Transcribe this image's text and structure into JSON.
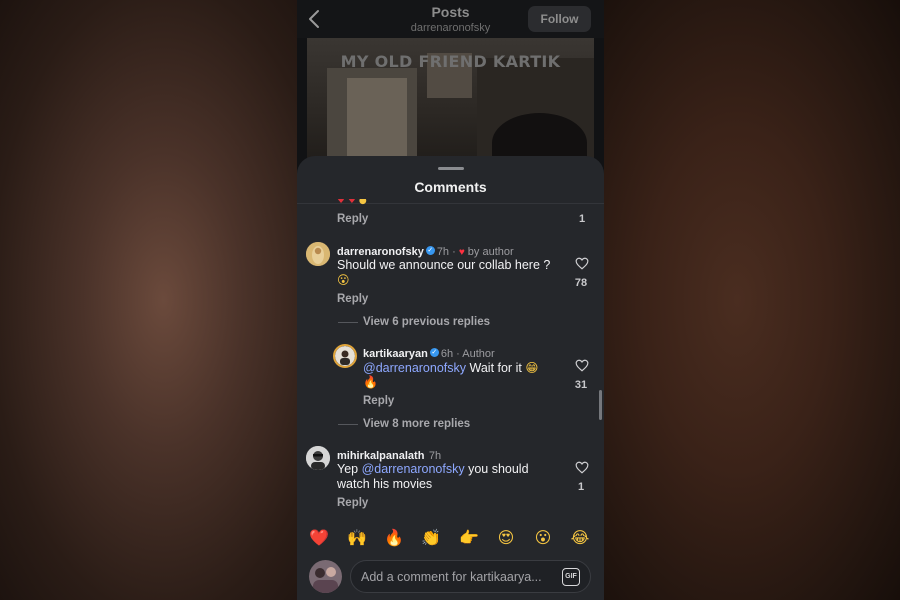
{
  "header": {
    "title": "Posts",
    "subtitle": "darrenaronofsky",
    "follow_label": "Follow"
  },
  "post": {
    "caption": "MY OLD FRIEND KARTIK"
  },
  "sheet": {
    "title": "Comments"
  },
  "partial_comment": {
    "reply_label": "Reply",
    "like_count": "1"
  },
  "comment_1": {
    "username": "darrenaronofsky",
    "time": "7h",
    "author_tag": "by author",
    "text": "Should we announce our collab here ?",
    "text_emoji": "😮",
    "reply_label": "Reply",
    "like_count": "78",
    "view_previous": "View 6 previous replies"
  },
  "reply_1": {
    "username": "kartikaaryan",
    "time": "6h",
    "author_label": "Author",
    "mention": "@darrenaronofsky",
    "text": "Wait for it",
    "text_emoji": "😁",
    "line2_emoji": "🔥",
    "reply_label": "Reply",
    "like_count": "31",
    "view_more": "View 8 more replies"
  },
  "comment_2": {
    "username": "mihirkalpanalath",
    "time": "7h",
    "text_prefix": "Yep",
    "mention": "@darrenaronofsky",
    "text_suffix": "you should",
    "text_line2": "watch his movies",
    "reply_label": "Reply",
    "like_count": "1"
  },
  "quick_reactions": [
    "❤️",
    "🙌",
    "🔥",
    "👏",
    "👉",
    "😍",
    "😮",
    "😂"
  ],
  "composer": {
    "placeholder": "Add a comment for kartikaarya...",
    "gif_label": "GIF"
  },
  "colors": {
    "sheet_bg": "#25272b",
    "mention": "#8ea8ff",
    "verified": "#3797f0",
    "heart_red": "#ff3040"
  }
}
